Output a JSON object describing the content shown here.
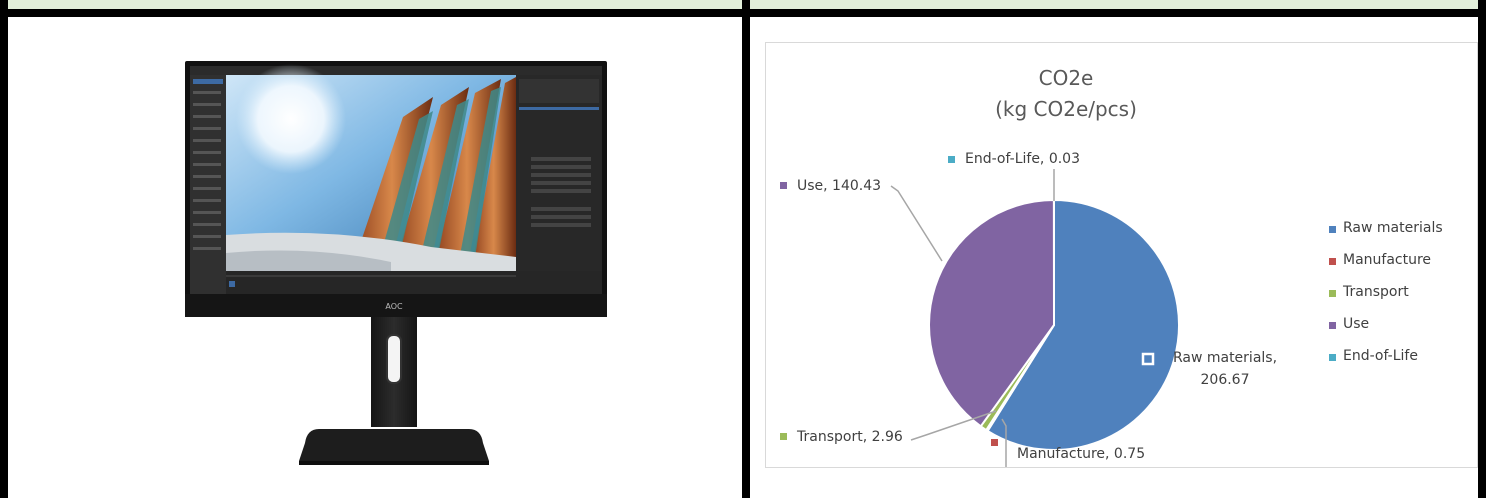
{
  "chart_data": {
    "type": "pie",
    "title_lines": [
      "CO2e",
      "(kg CO2e/pcs)"
    ],
    "categories": [
      "Raw materials",
      "Manufacture",
      "Transport",
      "Use",
      "End-of-Life"
    ],
    "values": [
      206.67,
      0.75,
      2.96,
      140.43,
      0.03
    ],
    "colors": [
      "#4f81bd",
      "#c0504d",
      "#9bbb59",
      "#8064a2",
      "#4bacc6"
    ],
    "data_labels": [
      {
        "category": "Raw materials",
        "text_lines": [
          "Raw materials,",
          "206.67"
        ]
      },
      {
        "category": "Manufacture",
        "text_lines": [
          "Manufacture, 0.75"
        ]
      },
      {
        "category": "Transport",
        "text_lines": [
          "Transport, 2.96"
        ]
      },
      {
        "category": "Use",
        "text_lines": [
          "Use, 140.43"
        ]
      },
      {
        "category": "End-of-Life",
        "text_lines": [
          "End-of-Life, 0.03"
        ]
      }
    ],
    "legend_position": "right"
  },
  "product_image": {
    "brand_text": "AOC"
  }
}
